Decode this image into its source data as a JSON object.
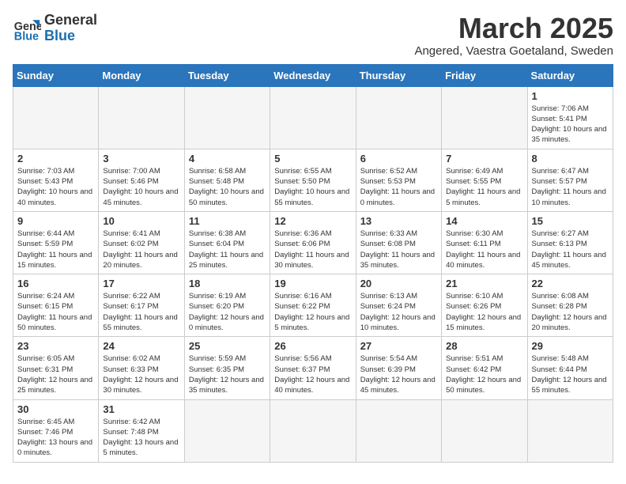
{
  "header": {
    "logo_general": "General",
    "logo_blue": "Blue",
    "month_title": "March 2025",
    "location": "Angered, Vaestra Goetaland, Sweden"
  },
  "days_of_week": [
    "Sunday",
    "Monday",
    "Tuesday",
    "Wednesday",
    "Thursday",
    "Friday",
    "Saturday"
  ],
  "weeks": [
    [
      {
        "day": null,
        "info": null
      },
      {
        "day": null,
        "info": null
      },
      {
        "day": null,
        "info": null
      },
      {
        "day": null,
        "info": null
      },
      {
        "day": null,
        "info": null
      },
      {
        "day": null,
        "info": null
      },
      {
        "day": "1",
        "info": "Sunrise: 7:06 AM\nSunset: 5:41 PM\nDaylight: 10 hours and 35 minutes."
      }
    ],
    [
      {
        "day": "2",
        "info": "Sunrise: 7:03 AM\nSunset: 5:43 PM\nDaylight: 10 hours and 40 minutes."
      },
      {
        "day": "3",
        "info": "Sunrise: 7:00 AM\nSunset: 5:46 PM\nDaylight: 10 hours and 45 minutes."
      },
      {
        "day": "4",
        "info": "Sunrise: 6:58 AM\nSunset: 5:48 PM\nDaylight: 10 hours and 50 minutes."
      },
      {
        "day": "5",
        "info": "Sunrise: 6:55 AM\nSunset: 5:50 PM\nDaylight: 10 hours and 55 minutes."
      },
      {
        "day": "6",
        "info": "Sunrise: 6:52 AM\nSunset: 5:53 PM\nDaylight: 11 hours and 0 minutes."
      },
      {
        "day": "7",
        "info": "Sunrise: 6:49 AM\nSunset: 5:55 PM\nDaylight: 11 hours and 5 minutes."
      },
      {
        "day": "8",
        "info": "Sunrise: 6:47 AM\nSunset: 5:57 PM\nDaylight: 11 hours and 10 minutes."
      }
    ],
    [
      {
        "day": "9",
        "info": "Sunrise: 6:44 AM\nSunset: 5:59 PM\nDaylight: 11 hours and 15 minutes."
      },
      {
        "day": "10",
        "info": "Sunrise: 6:41 AM\nSunset: 6:02 PM\nDaylight: 11 hours and 20 minutes."
      },
      {
        "day": "11",
        "info": "Sunrise: 6:38 AM\nSunset: 6:04 PM\nDaylight: 11 hours and 25 minutes."
      },
      {
        "day": "12",
        "info": "Sunrise: 6:36 AM\nSunset: 6:06 PM\nDaylight: 11 hours and 30 minutes."
      },
      {
        "day": "13",
        "info": "Sunrise: 6:33 AM\nSunset: 6:08 PM\nDaylight: 11 hours and 35 minutes."
      },
      {
        "day": "14",
        "info": "Sunrise: 6:30 AM\nSunset: 6:11 PM\nDaylight: 11 hours and 40 minutes."
      },
      {
        "day": "15",
        "info": "Sunrise: 6:27 AM\nSunset: 6:13 PM\nDaylight: 11 hours and 45 minutes."
      }
    ],
    [
      {
        "day": "16",
        "info": "Sunrise: 6:24 AM\nSunset: 6:15 PM\nDaylight: 11 hours and 50 minutes."
      },
      {
        "day": "17",
        "info": "Sunrise: 6:22 AM\nSunset: 6:17 PM\nDaylight: 11 hours and 55 minutes."
      },
      {
        "day": "18",
        "info": "Sunrise: 6:19 AM\nSunset: 6:20 PM\nDaylight: 12 hours and 0 minutes."
      },
      {
        "day": "19",
        "info": "Sunrise: 6:16 AM\nSunset: 6:22 PM\nDaylight: 12 hours and 5 minutes."
      },
      {
        "day": "20",
        "info": "Sunrise: 6:13 AM\nSunset: 6:24 PM\nDaylight: 12 hours and 10 minutes."
      },
      {
        "day": "21",
        "info": "Sunrise: 6:10 AM\nSunset: 6:26 PM\nDaylight: 12 hours and 15 minutes."
      },
      {
        "day": "22",
        "info": "Sunrise: 6:08 AM\nSunset: 6:28 PM\nDaylight: 12 hours and 20 minutes."
      }
    ],
    [
      {
        "day": "23",
        "info": "Sunrise: 6:05 AM\nSunset: 6:31 PM\nDaylight: 12 hours and 25 minutes."
      },
      {
        "day": "24",
        "info": "Sunrise: 6:02 AM\nSunset: 6:33 PM\nDaylight: 12 hours and 30 minutes."
      },
      {
        "day": "25",
        "info": "Sunrise: 5:59 AM\nSunset: 6:35 PM\nDaylight: 12 hours and 35 minutes."
      },
      {
        "day": "26",
        "info": "Sunrise: 5:56 AM\nSunset: 6:37 PM\nDaylight: 12 hours and 40 minutes."
      },
      {
        "day": "27",
        "info": "Sunrise: 5:54 AM\nSunset: 6:39 PM\nDaylight: 12 hours and 45 minutes."
      },
      {
        "day": "28",
        "info": "Sunrise: 5:51 AM\nSunset: 6:42 PM\nDaylight: 12 hours and 50 minutes."
      },
      {
        "day": "29",
        "info": "Sunrise: 5:48 AM\nSunset: 6:44 PM\nDaylight: 12 hours and 55 minutes."
      }
    ],
    [
      {
        "day": "30",
        "info": "Sunrise: 6:45 AM\nSunset: 7:46 PM\nDaylight: 13 hours and 0 minutes."
      },
      {
        "day": "31",
        "info": "Sunrise: 6:42 AM\nSunset: 7:48 PM\nDaylight: 13 hours and 5 minutes."
      },
      {
        "day": null,
        "info": null
      },
      {
        "day": null,
        "info": null
      },
      {
        "day": null,
        "info": null
      },
      {
        "day": null,
        "info": null
      },
      {
        "day": null,
        "info": null
      }
    ]
  ]
}
